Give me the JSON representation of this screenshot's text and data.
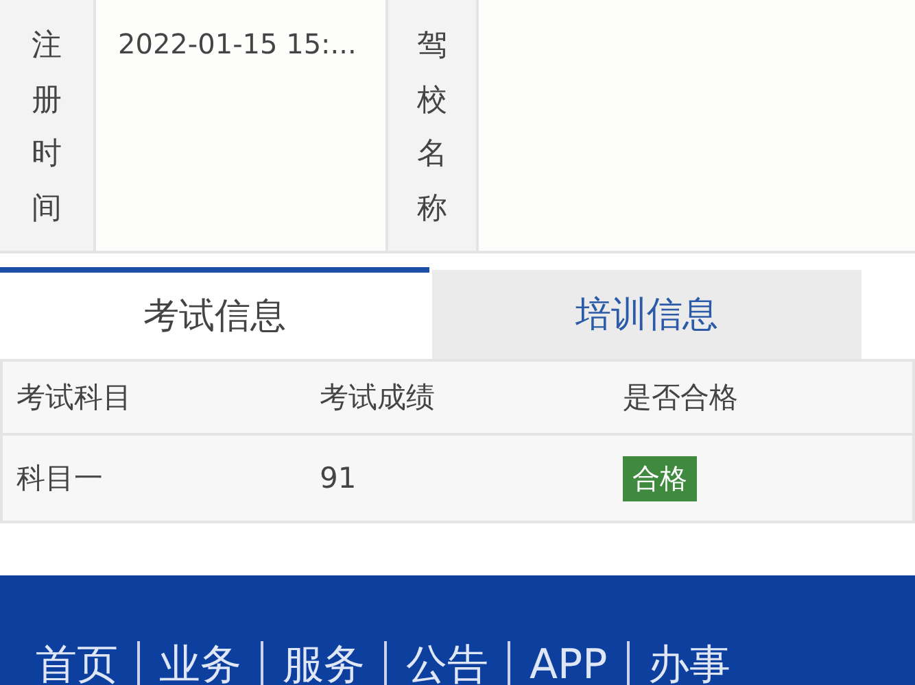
{
  "info_row": [
    {
      "label": "注册时间",
      "value": "2022-01-15 15:..."
    },
    {
      "label": "驾校名称"
    }
  ],
  "tabs": [
    {
      "label": "考试信息",
      "selected": true
    },
    {
      "label": "培训信息",
      "selected": false
    }
  ],
  "table": {
    "columns": [
      "考试科目",
      "考试成绩",
      "是否合格"
    ],
    "rows": [
      {
        "subject": "科目一",
        "score": "91",
        "result": "合格",
        "passed": true
      }
    ]
  },
  "footer": {
    "links": [
      "首页",
      "业务",
      "服务",
      "公告",
      "APP",
      "办事"
    ]
  }
}
